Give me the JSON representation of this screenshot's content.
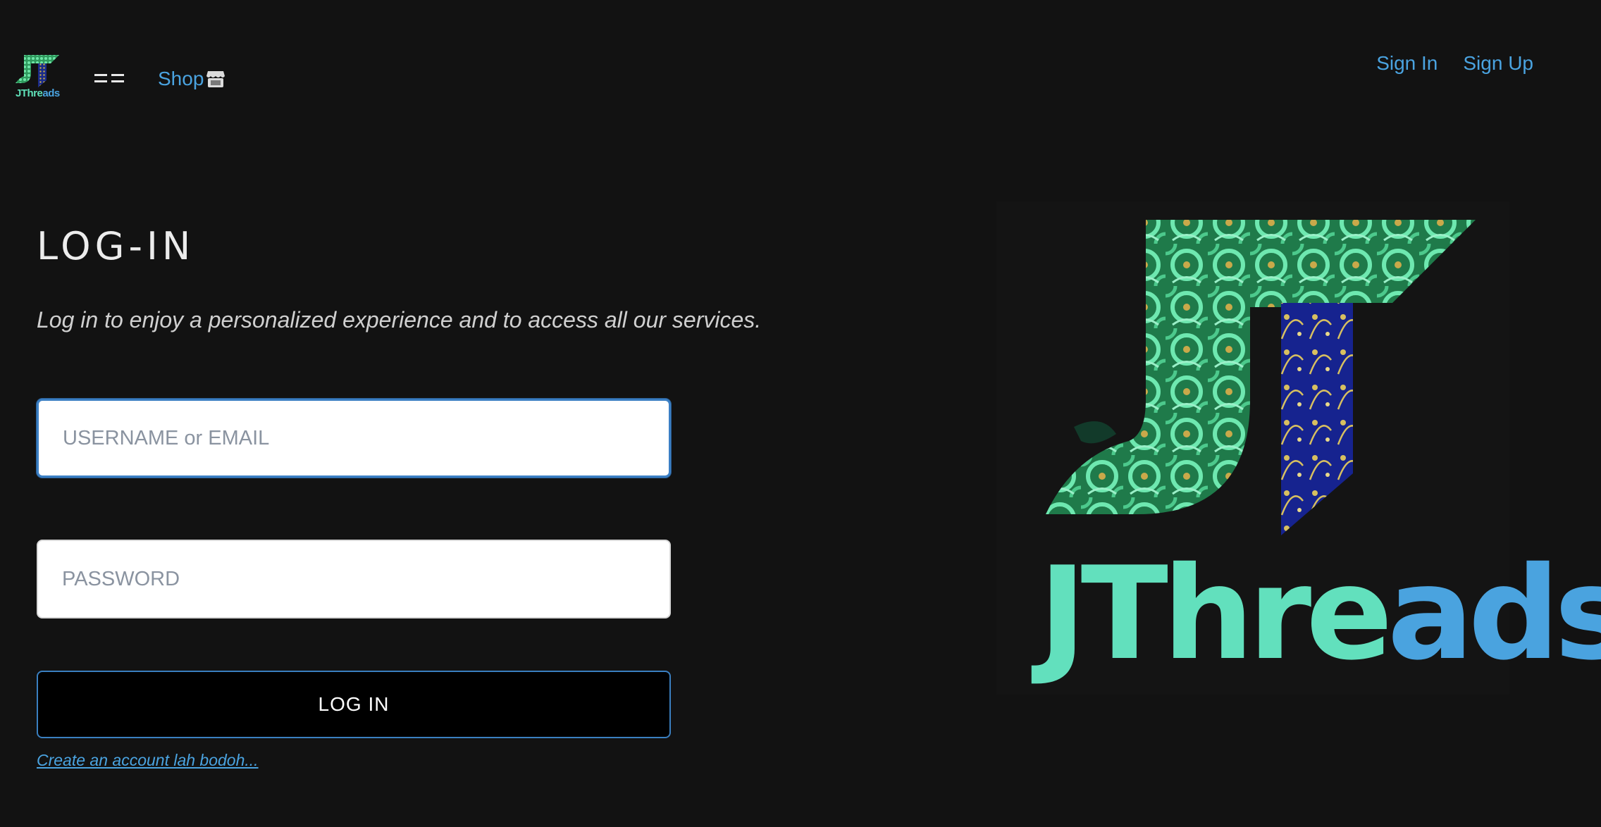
{
  "header": {
    "brand": {
      "word_part1": "JThre",
      "word_part2": "ads"
    },
    "menu_toggle_label": "",
    "shop_label": "Shop",
    "nav": {
      "sign_in": "Sign In",
      "sign_up": "Sign Up"
    }
  },
  "login": {
    "title": "LOG-IN",
    "subtitle": "Log in to enjoy a personalized experience and to access all our services.",
    "username_placeholder": "USERNAME or EMAIL",
    "password_placeholder": "PASSWORD",
    "button_label": "LOG IN",
    "create_account_link": "Create an account lah bodoh..."
  },
  "hero": {
    "word_part1": "JThre",
    "word_part2": "ads"
  },
  "colors": {
    "background": "#121212",
    "link": "#4aa3e0",
    "logo_green": "#5fe0b8",
    "logo_blue": "#1f2fa0",
    "focus_border": "#3b7fc4"
  },
  "icons": [
    "jthreads-logo",
    "menu-icon",
    "store-icon"
  ]
}
